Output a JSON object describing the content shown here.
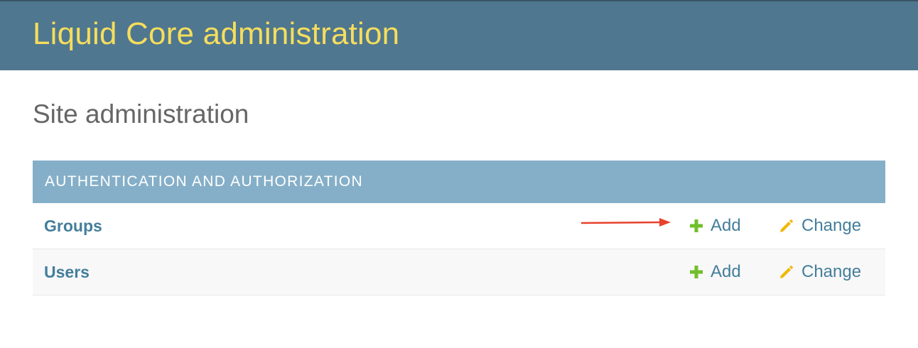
{
  "header": {
    "title": "Liquid Core administration"
  },
  "page": {
    "title": "Site administration"
  },
  "module": {
    "caption": "AUTHENTICATION AND AUTHORIZATION",
    "rows": [
      {
        "name": "Groups",
        "add_label": "Add",
        "change_label": "Change"
      },
      {
        "name": "Users",
        "add_label": "Add",
        "change_label": "Change"
      }
    ]
  },
  "colors": {
    "header_bg": "#4f778f",
    "brand": "#f5dd5d",
    "caption_bg": "#85afc8",
    "link": "#447e9b",
    "add_icon": "#70bf2b",
    "change_icon": "#efb80b",
    "annotation_arrow": "#e8412c"
  },
  "icons": {
    "add": "plus-icon",
    "change": "pencil-icon",
    "annotation": "arrow-right-icon"
  }
}
